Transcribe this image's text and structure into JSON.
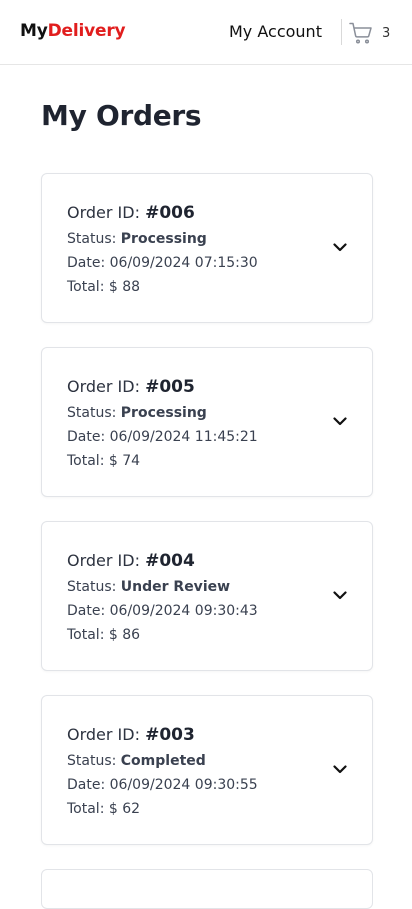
{
  "header": {
    "logo_part1": "My",
    "logo_part2": "Delivery",
    "account_label": "My Account",
    "cart_icon": "cart-icon",
    "cart_count": "3"
  },
  "page": {
    "title": "My Orders"
  },
  "labels": {
    "order_id_prefix": "Order ID:",
    "status_prefix": "Status:",
    "date_prefix": "Date:",
    "total_prefix": "Total:"
  },
  "orders": [
    {
      "id": "#006",
      "status": "Processing",
      "date": "06/09/2024 07:15:30",
      "total": "$ 88"
    },
    {
      "id": "#005",
      "status": "Processing",
      "date": "06/09/2024 11:45:21",
      "total": "$ 74"
    },
    {
      "id": "#004",
      "status": "Under Review",
      "date": "06/09/2024 09:30:43",
      "total": "$ 86"
    },
    {
      "id": "#003",
      "status": "Completed",
      "date": "06/09/2024 09:30:55",
      "total": "$ 62"
    }
  ],
  "colors": {
    "brand_red": "#e11d1d",
    "text_dark": "#1f2430",
    "border": "#e2e4e8"
  }
}
